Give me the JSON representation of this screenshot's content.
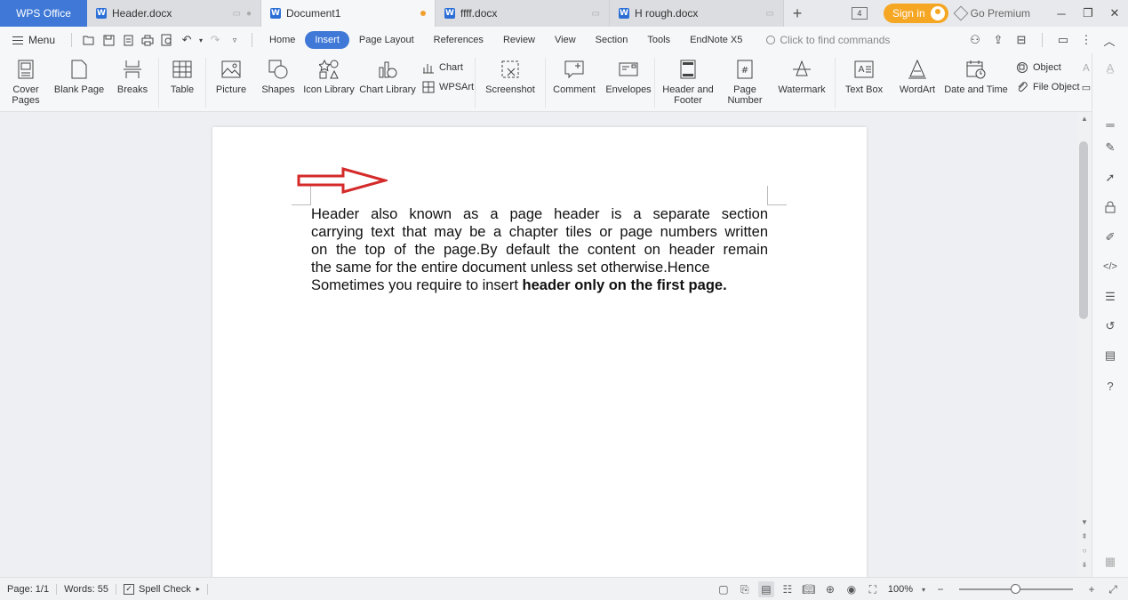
{
  "titlebar": {
    "app_tab": "WPS Office",
    "tabs": [
      {
        "name": "Header.docx",
        "active": false,
        "modified": false
      },
      {
        "name": "Document1",
        "active": true,
        "modified": true
      },
      {
        "name": "ffff.docx",
        "active": false,
        "modified": false
      },
      {
        "name": "H rough.docx",
        "active": false,
        "modified": false
      }
    ],
    "new_tab_symbol": "+",
    "tab_count": "4",
    "sign_in": "Sign in",
    "premium": "Go Premium"
  },
  "menubar": {
    "menu_label": "Menu",
    "tabs": [
      "Home",
      "Insert",
      "Page Layout",
      "References",
      "Review",
      "View",
      "Section",
      "Tools",
      "EndNote X5"
    ],
    "active_tab": "Insert",
    "search_placeholder": "Click to find commands"
  },
  "ribbon": {
    "cover_pages": "Cover\nPages",
    "blank_page": "Blank Page",
    "breaks": "Breaks",
    "table": "Table",
    "picture": "Picture",
    "shapes": "Shapes",
    "icon_library": "Icon Library",
    "chart_library": "Chart Library",
    "chart": "Chart",
    "wpsart": "WPSArt",
    "screenshot": "Screenshot",
    "comment": "Comment",
    "envelopes": "Envelopes",
    "header_footer": "Header and\nFooter",
    "page_number": "Page\nNumber",
    "watermark": "Watermark",
    "text_box": "Text Box",
    "wordart": "WordArt",
    "date_time": "Date and Time",
    "object": "Object",
    "file_object": "File Object"
  },
  "document": {
    "lines": [
      "Header also known as a page header is a separate section",
      "carrying text that may be a chapter tiles or page numbers written",
      "on the top of the page.By default the content on  header remain",
      "the same for the entire document unless set otherwise.Hence"
    ],
    "last_line_normal": "Sometimes you require to insert ",
    "last_line_bold": "header only on the first page."
  },
  "statusbar": {
    "page": "Page: 1/1",
    "words": "Words: 55",
    "spell_check": "Spell Check",
    "zoom": "100%",
    "zoom_level": 0.5
  },
  "colors": {
    "accent": "#3f78d6",
    "signin": "#f5a623",
    "arrow": "#d42a2a"
  }
}
